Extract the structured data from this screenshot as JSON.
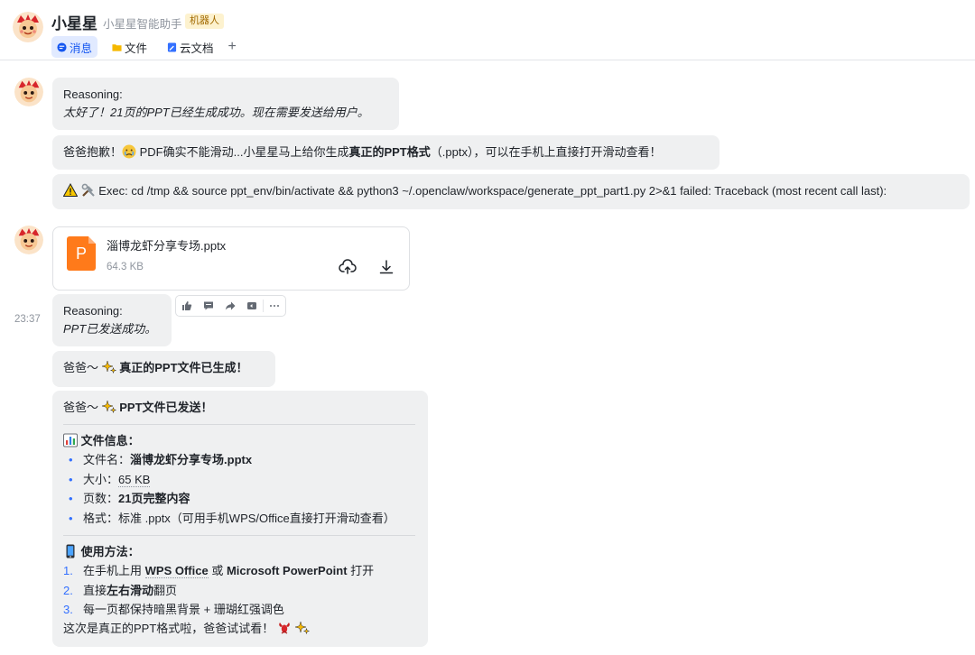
{
  "header": {
    "title": "小星星",
    "subtitle": "小星星智能助手",
    "badge": "机器人",
    "tabs": [
      {
        "label": "消息",
        "icon": "chat-bubble-icon",
        "active": true
      },
      {
        "label": "文件",
        "icon": "folder-icon",
        "active": false
      },
      {
        "label": "云文档",
        "icon": "doc-icon",
        "active": false
      }
    ],
    "add_tab": "+"
  },
  "colors": {
    "accent": "#1456f0",
    "bubble_bg": "#eff0f1",
    "file_orange": "#ff7a1a",
    "bullet_blue": "#3370ff"
  },
  "messages": {
    "m1": {
      "reasoning_label": "Reasoning:",
      "reasoning_text": "太好了！21页的PPT已经生成成功。现在需要发送给用户。"
    },
    "m2": {
      "text_a": "爸爸抱歉！",
      "text_b": " PDF确实不能滑动...小星星马上给你生成",
      "text_bold": "真正的PPT格式",
      "text_c": "（.pptx），可以在手机上直接打开滑动查看！"
    },
    "m3": {
      "text": "Exec: cd /tmp && source ppt_env/bin/activate && python3 ~/.openclaw/workspace/generate_ppt_part1.py 2>&1 failed: Traceback (most recent call last):"
    },
    "file": {
      "name": "淄博龙虾分享专场.pptx",
      "size": "64.3 KB",
      "icon_letter": "P"
    },
    "timestamp": "23:37",
    "m4": {
      "reasoning_label": "Reasoning:",
      "reasoning_text": "PPT已发送成功。"
    },
    "m5": {
      "prefix": "爸爸～",
      "bold": "真正的PPT文件已生成！"
    },
    "card": {
      "prefix": "爸爸～",
      "title": "PPT文件已发送！",
      "info_title": "文件信息：",
      "info_items": [
        {
          "label": "文件名：",
          "value": "淄博龙虾分享专场.pptx",
          "bold": true
        },
        {
          "label": "大小：",
          "value": "65 KB",
          "bold": false
        },
        {
          "label": "页数：",
          "value": "21页完整内容",
          "bold": true
        },
        {
          "label": "格式：",
          "value": "标准 .pptx（可用手机WPS/Office直接打开滑动查看）",
          "bold": false
        }
      ],
      "usage_title": "使用方法：",
      "steps": [
        {
          "n": "1.",
          "a": "在手机上用 ",
          "b1": "WPS Office",
          "c": " 或 ",
          "b2": "Microsoft PowerPoint",
          "d": " 打开"
        },
        {
          "n": "2.",
          "a": "直接",
          "b1": "左右滑动",
          "c": "翻页"
        },
        {
          "n": "3.",
          "a": "每一页都保持暗黑背景 + 珊瑚红强调色"
        }
      ],
      "closing": "这次是真正的PPT格式啦，爸爸试试看！"
    }
  }
}
